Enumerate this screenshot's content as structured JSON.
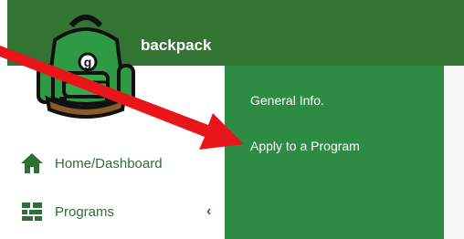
{
  "app": {
    "brand": "backpack"
  },
  "sidebar": {
    "items": [
      {
        "label": "Home/Dashboard",
        "icon": "home-icon"
      },
      {
        "label": "Programs",
        "icon": "programs-icon",
        "expand_icon": "chevron-left-icon"
      }
    ]
  },
  "submenu": {
    "items": [
      {
        "label": "General Info."
      },
      {
        "label": "Apply to a Program"
      }
    ]
  },
  "colors": {
    "header": "#347432",
    "submenu": "#2e8b43",
    "accent_text": "#2f6f35",
    "arrow": "#e8151a"
  }
}
